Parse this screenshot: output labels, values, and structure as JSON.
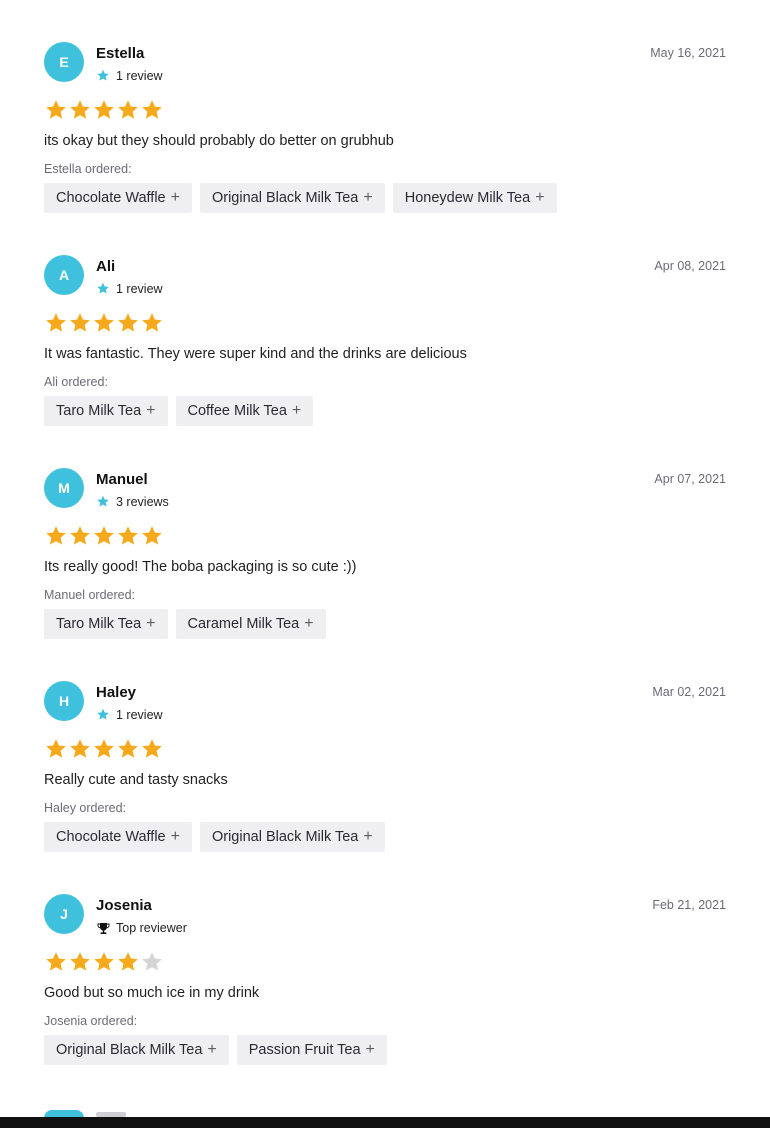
{
  "colors": {
    "avatar_bg": "#3fc0dc",
    "star_filled": "#f5a91b",
    "star_empty": "#d5d5d5",
    "meta_star": "#3fc0dc",
    "chip_bg": "#efeff1",
    "muted_text": "#6b6b78"
  },
  "reviews": [
    {
      "initial": "E",
      "name": "Estella",
      "meta_icon": "star-icon",
      "meta_text": "1 review",
      "date": "May 16, 2021",
      "rating": 5,
      "text": "its okay but they should probably do better on grubhub",
      "ordered_label": "Estella ordered:",
      "items": [
        "Chocolate Waffle",
        "Original Black Milk Tea",
        "Honeydew Milk Tea"
      ]
    },
    {
      "initial": "A",
      "name": "Ali",
      "meta_icon": "star-icon",
      "meta_text": "1 review",
      "date": "Apr 08, 2021",
      "rating": 5,
      "text": "It was fantastic. They were super kind and the drinks are delicious",
      "ordered_label": "Ali ordered:",
      "items": [
        "Taro Milk Tea",
        "Coffee Milk Tea"
      ]
    },
    {
      "initial": "M",
      "name": "Manuel",
      "meta_icon": "star-icon",
      "meta_text": "3 reviews",
      "date": "Apr 07, 2021",
      "rating": 5,
      "text": "Its really good! The boba packaging is so cute :))",
      "ordered_label": "Manuel ordered:",
      "items": [
        "Taro Milk Tea",
        "Caramel Milk Tea"
      ]
    },
    {
      "initial": "H",
      "name": "Haley",
      "meta_icon": "star-icon",
      "meta_text": "1 review",
      "date": "Mar 02, 2021",
      "rating": 5,
      "text": "Really cute and tasty snacks",
      "ordered_label": "Haley ordered:",
      "items": [
        "Chocolate Waffle",
        "Original Black Milk Tea"
      ]
    },
    {
      "initial": "J",
      "name": "Josenia",
      "meta_icon": "trophy-icon",
      "meta_text": "Top reviewer",
      "date": "Feb 21, 2021",
      "rating": 4,
      "text": "Good but so much ice in my drink",
      "ordered_label": "Josenia ordered:",
      "items": [
        "Original Black Milk Tea",
        "Passion Fruit Tea"
      ]
    }
  ],
  "add_symbol": "+"
}
